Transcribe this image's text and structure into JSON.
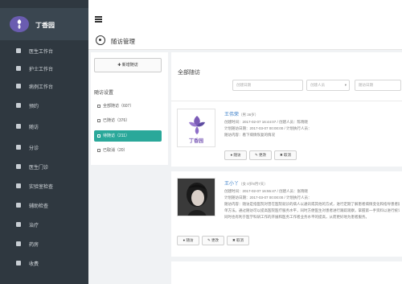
{
  "brand": {
    "name": "丁香园"
  },
  "sidebar": {
    "items": [
      {
        "label": "医生工作台",
        "icon": "home-icon"
      },
      {
        "label": "护士工作台",
        "icon": "monitor-icon"
      },
      {
        "label": "病例工作台",
        "icon": "record-icon"
      },
      {
        "label": "预约",
        "icon": "calendar-icon"
      },
      {
        "label": "随访",
        "icon": "edit-icon"
      },
      {
        "label": "分诊",
        "icon": "users-icon"
      },
      {
        "label": "医生门诊",
        "icon": "clinic-icon"
      },
      {
        "label": "实验室检查",
        "icon": "lab-icon"
      },
      {
        "label": "辅助检查",
        "icon": "gear-icon"
      },
      {
        "label": "治疗",
        "icon": "treatment-icon"
      },
      {
        "label": "药房",
        "icon": "pharmacy-icon"
      },
      {
        "label": "收费",
        "icon": "billing-icon"
      }
    ]
  },
  "page": {
    "title": "随访管理"
  },
  "filter": {
    "add_label": "✚ 新增随访",
    "title": "随访设置",
    "items": [
      {
        "label": "全部随访（607）"
      },
      {
        "label": "已随访（376）"
      },
      {
        "label": "待随访（211）"
      },
      {
        "label": "已取消（20）"
      }
    ]
  },
  "list": {
    "title": "全部随访",
    "search": {
      "date_placeholder": "创建日期",
      "person_placeholder": "创建人员",
      "visit_placeholder": "随访日期"
    },
    "cards": [
      {
        "name": "王伟荣",
        "name_sub": "（男 36岁）",
        "line1": "创建时间：2017-02-07 16:44:07 / 创建人员：陈晓晓",
        "line2": "计划随访日期：2017-03-07 00:00:00 / 计划执行人员：",
        "line3": "随访内容：看下病情恢复的情况",
        "logo_text": "丁香园"
      },
      {
        "name": "王小丫",
        "name_sub": "（女 0岁8月7天）",
        "line1": "创建时间：2017-02-07 16:55:47 / 创建人员：张晓晓",
        "line2": "计划随访日期：2017-03-07 00:00:00 / 计划执行人员：",
        "line3": "随访内容：随访是指医院对曾在医院就诊的病人以通讯或其他的方式，进行定期了解患者病情变化和指导患者康复的一种观察方法。",
        "line4": "单方法。通过随访可以提高医院医疗服务水平，同时方便医生对患者进行跟踪观察，掌握第一手资料以进行统计分析、积累经验，",
        "line5": "同时也有利于医学科研工作的开展和医务工作者业务水平的提高，从而更好地为患者服务。"
      }
    ],
    "actions": {
      "follow": "● 随访",
      "edit": "✎ 更改",
      "cancel": "✖ 取消"
    }
  },
  "colors": {
    "sidebar": "#2f3840",
    "accent": "#2aa89a",
    "link": "#3b7fc9",
    "brand": "#6a5cb0"
  }
}
